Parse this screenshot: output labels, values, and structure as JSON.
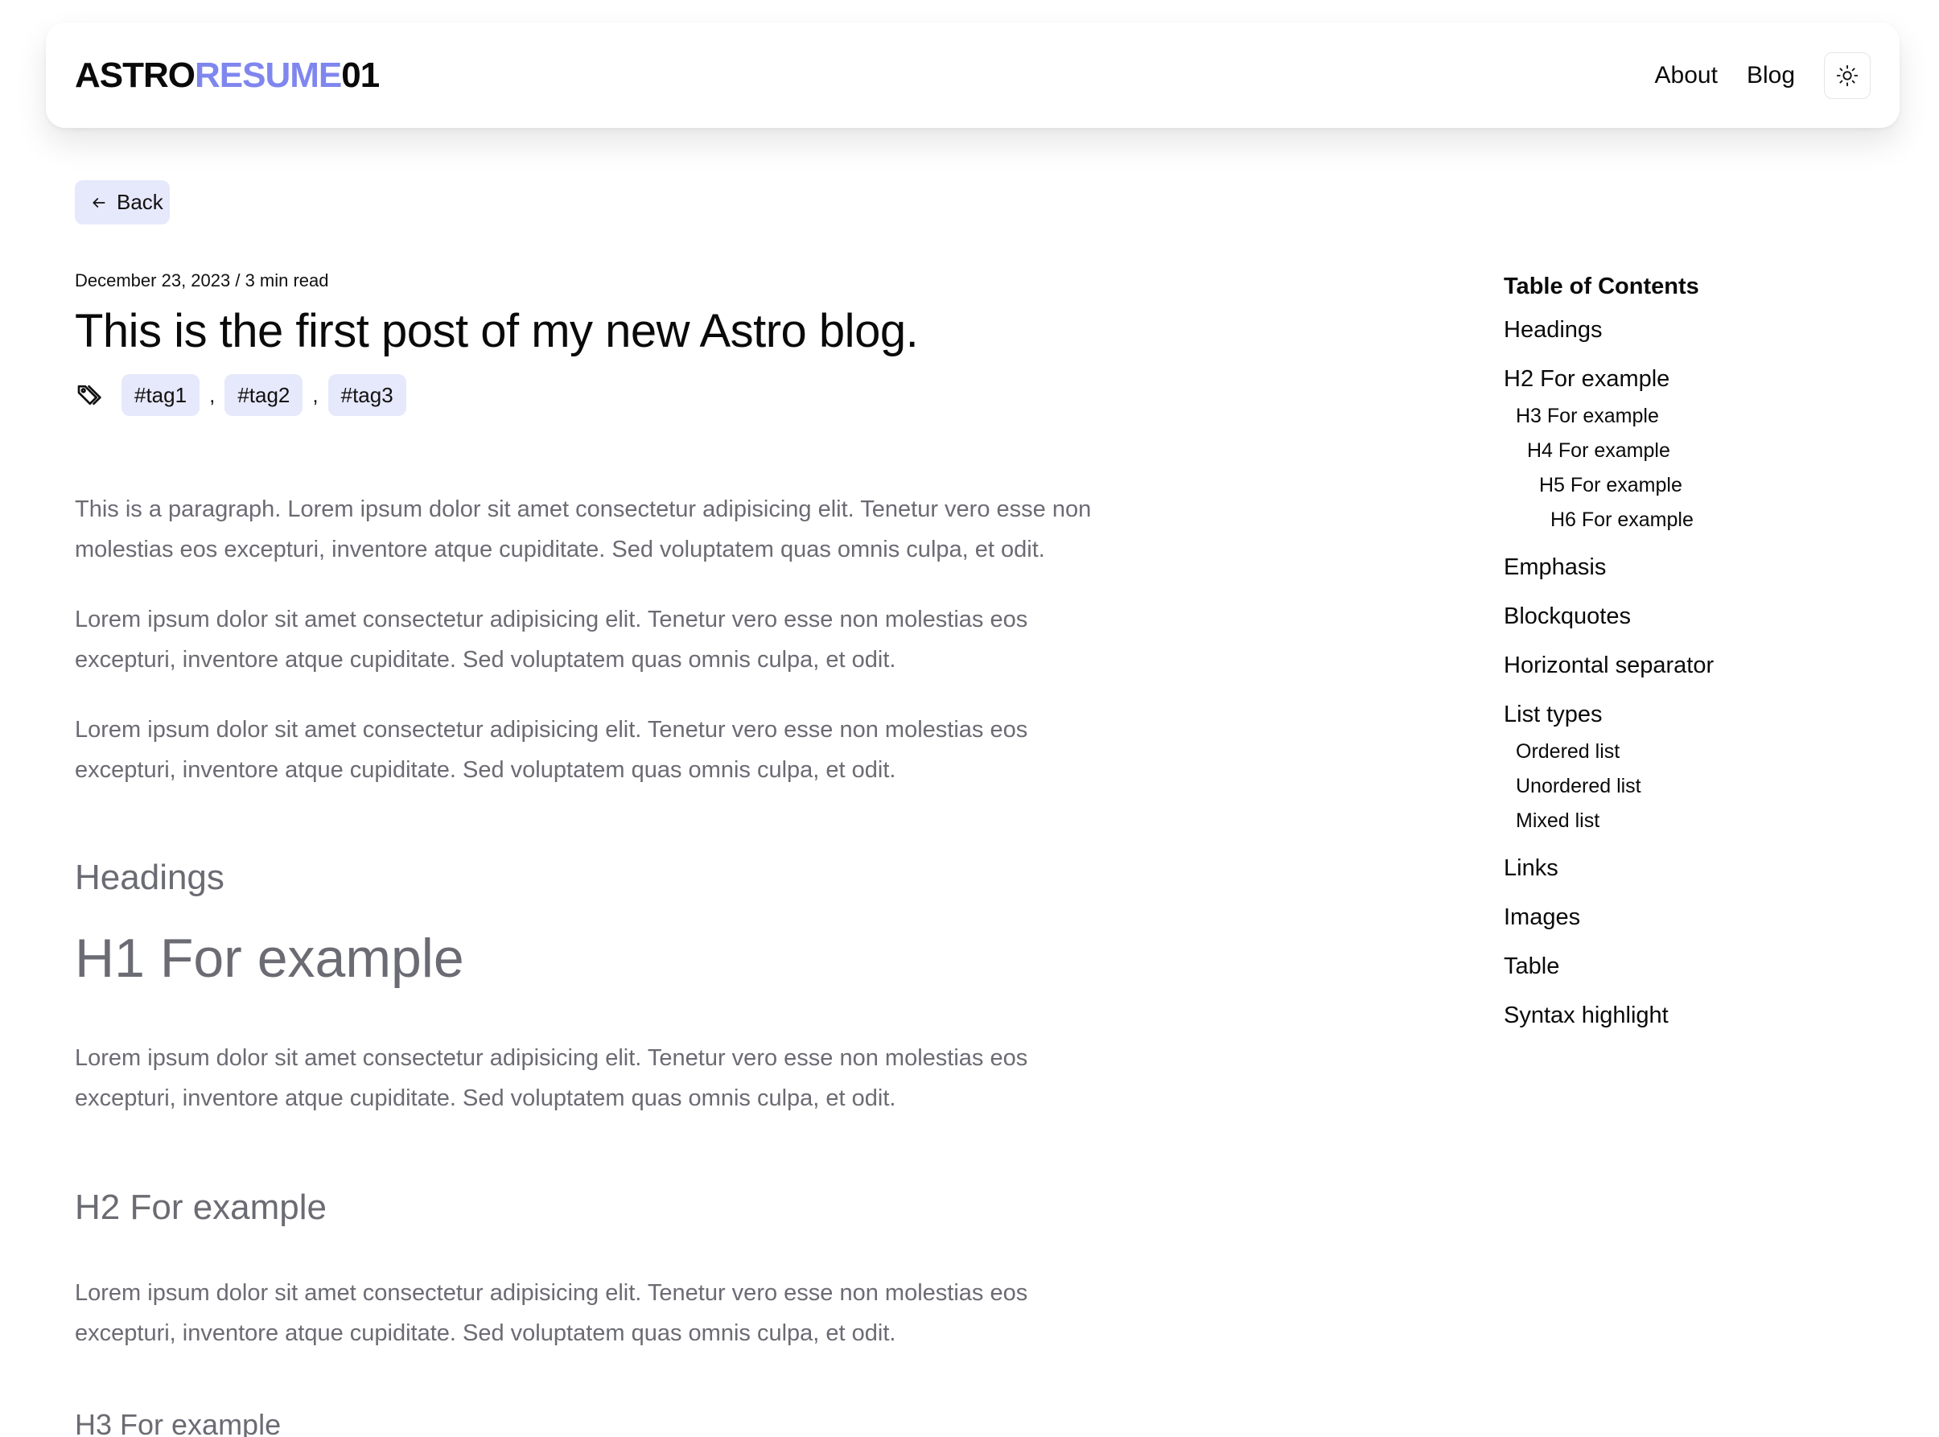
{
  "header": {
    "logo": {
      "part1": "ASTRO",
      "part2": "RESUME",
      "part3": "01"
    },
    "nav": {
      "about": "About",
      "blog": "Blog"
    },
    "theme_toggle_icon": "sun-icon"
  },
  "back_button": {
    "label": "Back",
    "icon": "arrow-left-icon"
  },
  "article": {
    "meta": "December 23, 2023 / 3 min read",
    "title": "This is the first post of my new Astro blog.",
    "tags": [
      "#tag1",
      "#tag2",
      "#tag3"
    ],
    "tag_separator": ",",
    "paragraphs": [
      "This is a paragraph. Lorem ipsum dolor sit amet consectetur adipisicing elit. Tenetur vero esse non molestias eos excepturi, inventore atque cupiditate. Sed voluptatem quas omnis culpa, et odit.",
      "Lorem ipsum dolor sit amet consectetur adipisicing elit. Tenetur vero esse non molestias eos excepturi, inventore atque cupiditate. Sed voluptatem quas omnis culpa, et odit.",
      "Lorem ipsum dolor sit amet consectetur adipisicing elit. Tenetur vero esse non molestias eos excepturi, inventore atque cupiditate. Sed voluptatem quas omnis culpa, et odit."
    ],
    "headings_title": "Headings",
    "h1_example": "H1 For example",
    "h1_paragraph": "Lorem ipsum dolor sit amet consectetur adipisicing elit. Tenetur vero esse non molestias eos excepturi, inventore atque cupiditate. Sed voluptatem quas omnis culpa, et odit.",
    "h2_example": "H2 For example",
    "h2_paragraph": "Lorem ipsum dolor sit amet consectetur adipisicing elit. Tenetur vero esse non molestias eos excepturi, inventore atque cupiditate. Sed voluptatem quas omnis culpa, et odit.",
    "h3_example": "H3 For example"
  },
  "toc": {
    "title": "Table of Contents",
    "headings": "Headings",
    "h2": "H2 For example",
    "h3": "H3 For example",
    "h4": "H4 For example",
    "h5": "H5 For example",
    "h6": "H6 For example",
    "emphasis": "Emphasis",
    "blockquotes": "Blockquotes",
    "horizontal_separator": "Horizontal separator",
    "list_types": "List types",
    "ordered_list": "Ordered list",
    "unordered_list": "Unordered list",
    "mixed_list": "Mixed list",
    "links": "Links",
    "images": "Images",
    "table": "Table",
    "syntax_highlight": "Syntax highlight"
  },
  "colors": {
    "accent": "#7f86ee",
    "tag_bg": "#e6e8fb",
    "body_text": "#6b6b73"
  }
}
